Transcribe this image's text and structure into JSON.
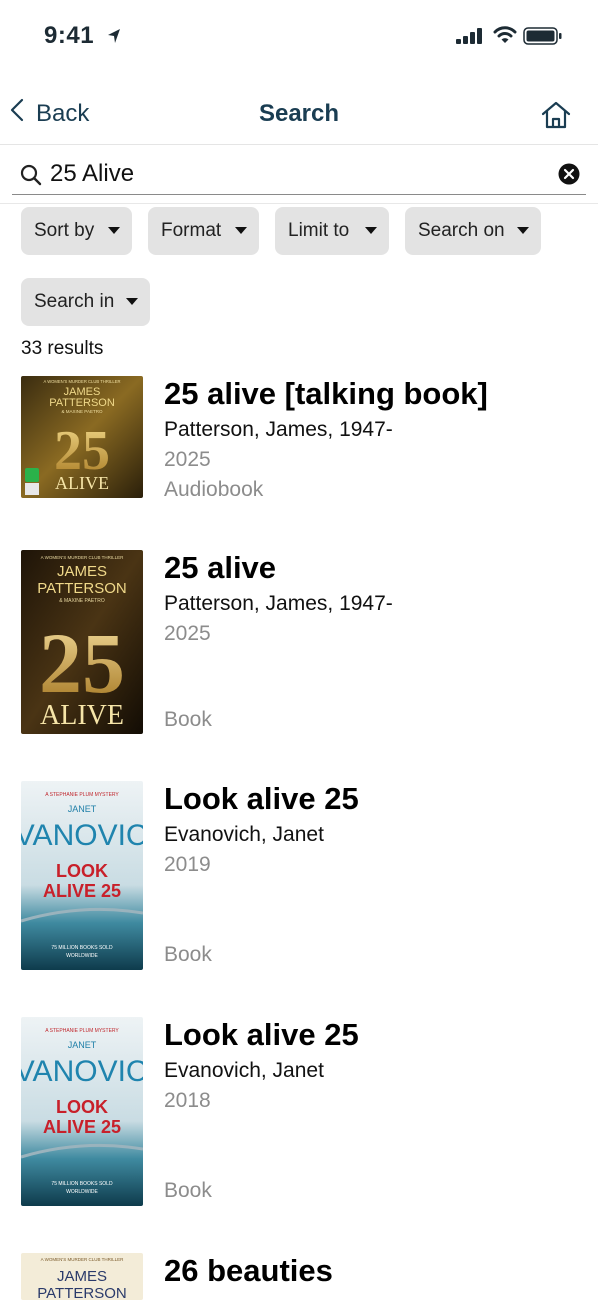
{
  "status": {
    "time": "9:41"
  },
  "nav": {
    "back_label": "Back",
    "title": "Search"
  },
  "search": {
    "value": "25 Alive"
  },
  "filters": {
    "sort_by": "Sort by",
    "format": "Format",
    "limit_to": "Limit to",
    "search_on": "Search on",
    "search_in": "Search in"
  },
  "results_count": "33 results",
  "results": [
    {
      "title": "25 alive [talking book]",
      "author": "Patterson, James, 1947-",
      "year": "2025",
      "format": "Audiobook",
      "cover": {
        "series": "A WOMEN'S MURDER CLUB THRILLER",
        "author_line1": "JAMES",
        "author_line2": "PATTERSON",
        "coauthor": "& MAXINE PAETRO",
        "number": "25",
        "word": "ALIVE"
      }
    },
    {
      "title": "25 alive",
      "author": "Patterson, James, 1947-",
      "year": "2025",
      "format": "Book",
      "cover": {
        "series": "A WOMEN'S MURDER CLUB THRILLER",
        "author_line1": "JAMES",
        "author_line2": "PATTERSON",
        "coauthor": "& MAXINE PAETRO",
        "number": "25",
        "word": "ALIVE"
      }
    },
    {
      "title": "Look alive 25",
      "author": "Evanovich, Janet",
      "year": "2019",
      "format": "Book",
      "cover": {
        "series": "A STEPHANIE PLUM MYSTERY",
        "first": "JANET",
        "last": "EVANOVICH",
        "line1": "LOOK",
        "line2": "ALIVE 25",
        "footer1": "75 MILLION BOOKS SOLD",
        "footer2": "WORLDWIDE"
      }
    },
    {
      "title": "Look alive 25",
      "author": "Evanovich, Janet",
      "year": "2018",
      "format": "Book",
      "cover": {
        "series": "A STEPHANIE PLUM MYSTERY",
        "first": "JANET",
        "last": "EVANOVICH",
        "line1": "LOOK",
        "line2": "ALIVE 25",
        "footer1": "75 MILLION BOOKS SOLD",
        "footer2": "WORLDWIDE"
      }
    },
    {
      "title": "26 beauties",
      "cover": {
        "series": "A WOMEN'S MURDER CLUB THRILLER",
        "author_line1": "JAMES",
        "author_line2": "PATTERSON"
      }
    }
  ],
  "colors": {
    "nav_text": "#1a3d52",
    "chip_bg": "#e3e3e3",
    "muted_text": "#8c8c8c"
  }
}
